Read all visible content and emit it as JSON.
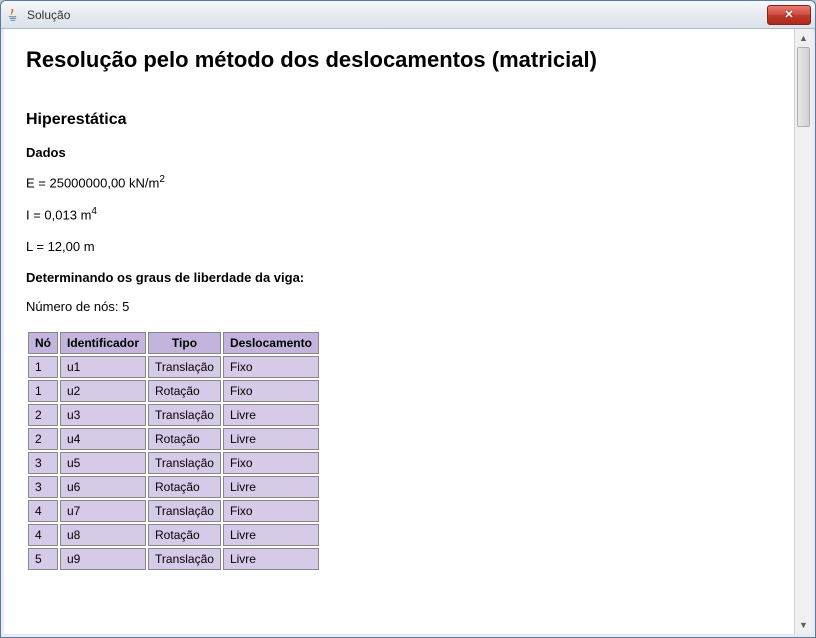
{
  "window": {
    "title": "Solução"
  },
  "content": {
    "heading": "Resolução pelo método dos deslocamentos (matricial)",
    "subheading": "Hiperestática",
    "dados_label": "Dados",
    "E_line": "E = 25000000,00 kN/m",
    "E_exp": "2",
    "I_line": "I = 0,013 m",
    "I_exp": "4",
    "L_line": "L = 12,00 m",
    "dof_label": "Determinando os graus de liberdade da viga:",
    "nodes_line": "Número de nós: 5"
  },
  "table": {
    "headers": [
      "Nó",
      "Identificador",
      "Tipo",
      "Deslocamento"
    ],
    "rows": [
      {
        "no": "1",
        "id": "u1",
        "tipo": "Translação",
        "desl": "Fixo"
      },
      {
        "no": "1",
        "id": "u2",
        "tipo": "Rotação",
        "desl": "Fixo"
      },
      {
        "no": "2",
        "id": "u3",
        "tipo": "Translação",
        "desl": "Livre"
      },
      {
        "no": "2",
        "id": "u4",
        "tipo": "Rotação",
        "desl": "Livre"
      },
      {
        "no": "3",
        "id": "u5",
        "tipo": "Translação",
        "desl": "Fixo"
      },
      {
        "no": "3",
        "id": "u6",
        "tipo": "Rotação",
        "desl": "Livre"
      },
      {
        "no": "4",
        "id": "u7",
        "tipo": "Translação",
        "desl": "Fixo"
      },
      {
        "no": "4",
        "id": "u8",
        "tipo": "Rotação",
        "desl": "Livre"
      },
      {
        "no": "5",
        "id": "u9",
        "tipo": "Translação",
        "desl": "Livre"
      }
    ]
  }
}
